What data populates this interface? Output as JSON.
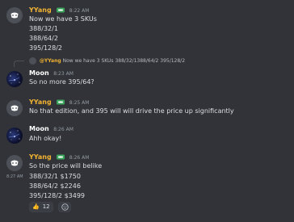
{
  "messages": [
    {
      "author": "YYang",
      "time": "8:22 AM",
      "lines": [
        "Now we have 3 SKUs",
        "388/32/1",
        "388/64/2",
        "395/128/2"
      ]
    },
    {
      "reply_author": "@YYang",
      "reply_text": "Now we have 3 SKUs 388/32/1388/64/2 395/128/2",
      "author": "Moon",
      "time": "8:23 AM",
      "lines": [
        "So no more 395/64?"
      ]
    },
    {
      "author": "YYang",
      "time": "8:25 AM",
      "lines": [
        "No that edition, and 395 will will drive the price up significantly"
      ]
    },
    {
      "author": "Moon",
      "time": "8:26 AM",
      "lines": [
        "Ahh okay!"
      ]
    },
    {
      "author": "YYang",
      "time": "8:26 AM",
      "lines": [
        "So the price will belike"
      ]
    },
    {
      "side_time": "8:27 AM",
      "lines": [
        "388/32/1  $1750",
        "388/64/2  $2246",
        "395/128/2  $3499"
      ]
    }
  ],
  "reactions": [
    {
      "emoji": "👍",
      "count": "12"
    },
    {
      "emoji": "add-reaction-icon"
    }
  ],
  "colors": {
    "background": "#313338",
    "yyang_name": "#f0b232",
    "moon_name": "#ffffff",
    "text": "#dbdee1",
    "muted": "#949ba4"
  }
}
